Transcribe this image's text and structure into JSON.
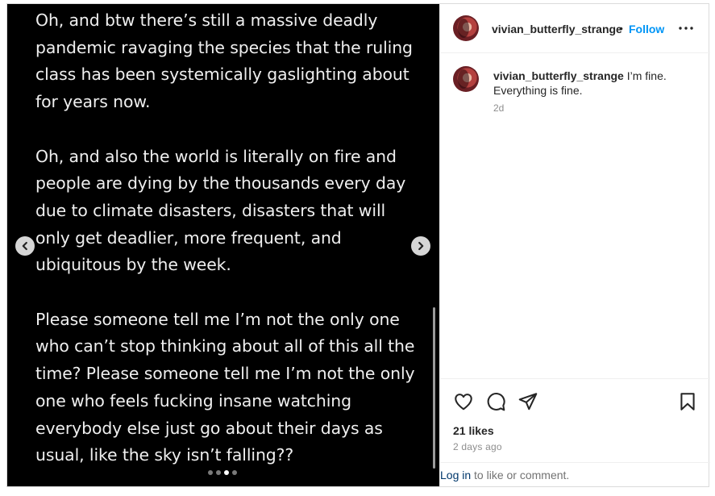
{
  "media": {
    "paragraphs": [
      "Oh, and btw there’s still a massive deadly\npandemic ravaging the species that the ruling\nclass has been systemically gaslighting about\nfor years now.",
      "Oh, and also the world is literally on fire and\npeople are dying by the thousands every day\ndue to climate disasters, disasters that will\nonly get deadlier, more frequent, and\nubiquitous by the week.",
      "Please someone tell me I’m not the only one\nwho can’t stop thinking about all of this all the\ntime? Please someone tell me I’m not the only\none who feels fucking insane watching\neverybody else just go about their days as\nusual, like the sky isn’t falling??"
    ],
    "carousel": {
      "total_slides": 4,
      "active_slide": 3
    }
  },
  "post": {
    "username": "vivian_butterfly_strange",
    "separator": "•",
    "follow_label": "Follow",
    "caption_text": " I’m fine. Everything is fine.",
    "caption_time": "2d",
    "likes": "21 likes",
    "posted": "2 days ago",
    "login_link": "Log in",
    "login_rest": " to like or comment."
  },
  "colors": {
    "accent": "#0095f6",
    "link": "#00376b",
    "media_bg": "#000000"
  },
  "icons": [
    "chevron-left-icon",
    "chevron-right-icon",
    "more-icon",
    "heart-icon",
    "comment-icon",
    "share-icon",
    "bookmark-icon"
  ]
}
